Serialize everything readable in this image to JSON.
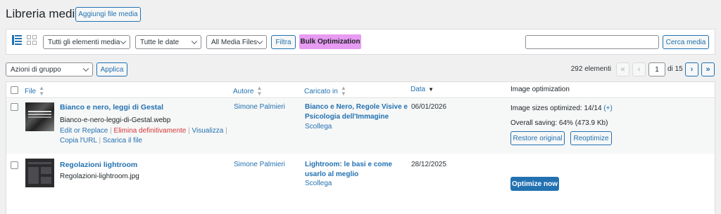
{
  "header": {
    "title": "Libreria media",
    "add_button": "Aggiungi file media"
  },
  "filters": {
    "type_select": "Tutti gli elementi media",
    "date_select": "Tutte le date",
    "media_files_select": "All Media Files",
    "filter_button": "Filtra",
    "bulk_optimization": "Bulk Optimization",
    "search_button": "Cerca media",
    "search_value": ""
  },
  "bulk_actions": {
    "select": "Azioni di gruppo",
    "apply": "Applica"
  },
  "pagination": {
    "count": "292 elementi",
    "first": "«",
    "prev": "‹",
    "current": "1",
    "of_label": "di 15",
    "next": "›",
    "last": "»"
  },
  "table": {
    "columns": {
      "file": "File",
      "author": "Autore",
      "uploaded_to": "Caricato in",
      "date": "Data",
      "image_optimization": "Image optimization"
    },
    "rows": [
      {
        "title": "Bianco e nero, leggi di Gestal",
        "filename": "Bianco-e-nero-leggi-di-Gestal.webp",
        "action_edit": "Edit or Replace",
        "action_delete": "Elimina definitivamente",
        "action_view": "Visualizza",
        "action_copy": "Copia l'URL",
        "action_download": "Scarica il file",
        "author": "Simone Palmieri",
        "uploaded_line1": "Bianco e Nero, Regole Visive e",
        "uploaded_line2": "Psicologia dell'Immagine",
        "detach": "Scollega",
        "date": "06/01/2026",
        "opt_sizes": "Image sizes optimized: 14/14",
        "opt_plus": "(+)",
        "opt_saving": "Overall saving: 64% (473.9 Kb)",
        "restore_button": "Restore original",
        "reoptimize_button": "Reoptimize"
      },
      {
        "title": "Regolazioni lightroom",
        "filename": "Regolazioni-lightroom.jpg",
        "author": "Simone Palmieri",
        "uploaded_line1": "Lightroom: le basi e come",
        "uploaded_line2": "usarlo al meglio",
        "detach": "Scollega",
        "date": "28/12/2025",
        "optimize_button": "Optimize now"
      }
    ]
  },
  "colors": {
    "accent": "#2271b1",
    "bulk_optimization_bg": "#e89bf3",
    "danger": "#d63638"
  },
  "icons": {
    "list_view": "list-view-icon",
    "grid_view": "grid-view-icon",
    "sort": "sort-arrows-icon",
    "chevron": "chevron-down-icon"
  }
}
